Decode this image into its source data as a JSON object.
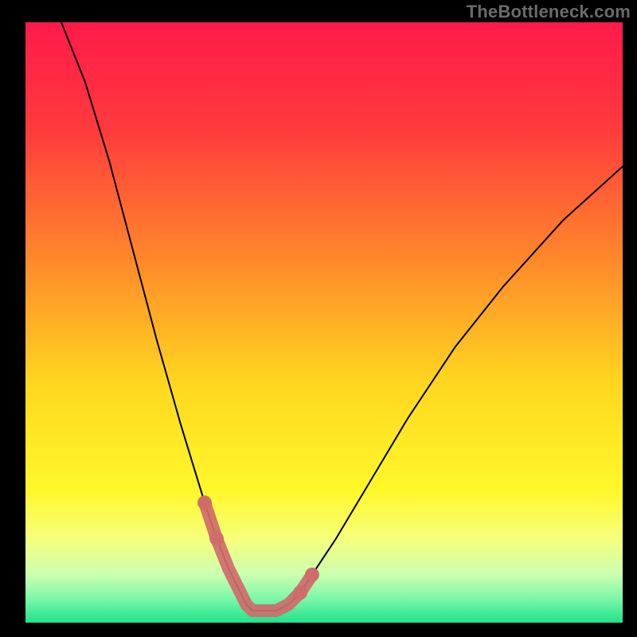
{
  "watermark": "TheBottleneck.com",
  "chart_data": {
    "type": "line",
    "title": "",
    "xlabel": "",
    "ylabel": "",
    "xlim": [
      0,
      100
    ],
    "ylim": [
      0,
      100
    ],
    "gradient_stops": [
      {
        "offset": 0.0,
        "color": "#ff1a4a"
      },
      {
        "offset": 0.18,
        "color": "#ff3b3d"
      },
      {
        "offset": 0.4,
        "color": "#ff8a2a"
      },
      {
        "offset": 0.6,
        "color": "#ffd61f"
      },
      {
        "offset": 0.78,
        "color": "#fff82a"
      },
      {
        "offset": 0.86,
        "color": "#f6ff7a"
      },
      {
        "offset": 0.92,
        "color": "#caffb0"
      },
      {
        "offset": 0.96,
        "color": "#7cf7a8"
      },
      {
        "offset": 1.0,
        "color": "#1fe28a"
      }
    ],
    "series": [
      {
        "name": "bottleneck-curve",
        "x": [
          6,
          10,
          14,
          18,
          22,
          26,
          30,
          32,
          34,
          36,
          37,
          38,
          39,
          40,
          42,
          44,
          46,
          48,
          52,
          58,
          64,
          72,
          80,
          90,
          100
        ],
        "y": [
          100,
          90,
          77,
          62,
          47,
          33,
          20,
          14,
          9,
          5,
          3,
          2,
          2,
          2,
          2,
          3,
          5,
          8,
          14,
          24,
          34,
          46,
          56,
          67,
          76
        ]
      }
    ],
    "marker_band_y": [
      2,
      10
    ],
    "marker_color": "#cf6b6b",
    "marker_points_x": [
      30,
      32,
      34,
      36,
      37,
      38,
      39,
      40,
      42,
      44,
      46,
      48
    ]
  }
}
